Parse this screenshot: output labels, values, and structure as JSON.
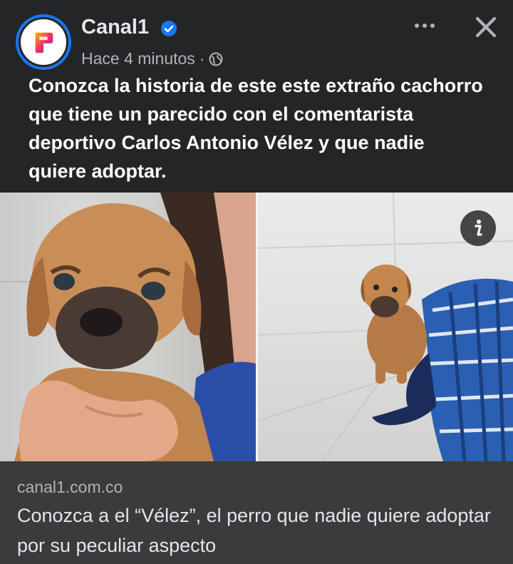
{
  "post": {
    "page_name": "Canal1",
    "timestamp": "Hace 4 minutos",
    "separator": "·",
    "caption": "Conozca la historia de este este extraño cachorro que tiene un parecido con el comentarista deportivo Carlos Antonio Vélez y que nadie quiere adoptar.",
    "verified_icon": "verified-badge-icon",
    "privacy_icon": "globe-icon"
  },
  "link_preview": {
    "domain": "canal1.com.co",
    "title": "Conozca a el “Vélez”, el perro que nadie quiere adoptar por su peculiar aspecto"
  },
  "colors": {
    "background": "#242526",
    "link_box": "#3a3b3c",
    "verified": "#1877f2",
    "secondary_text": "#b0b3b8"
  }
}
